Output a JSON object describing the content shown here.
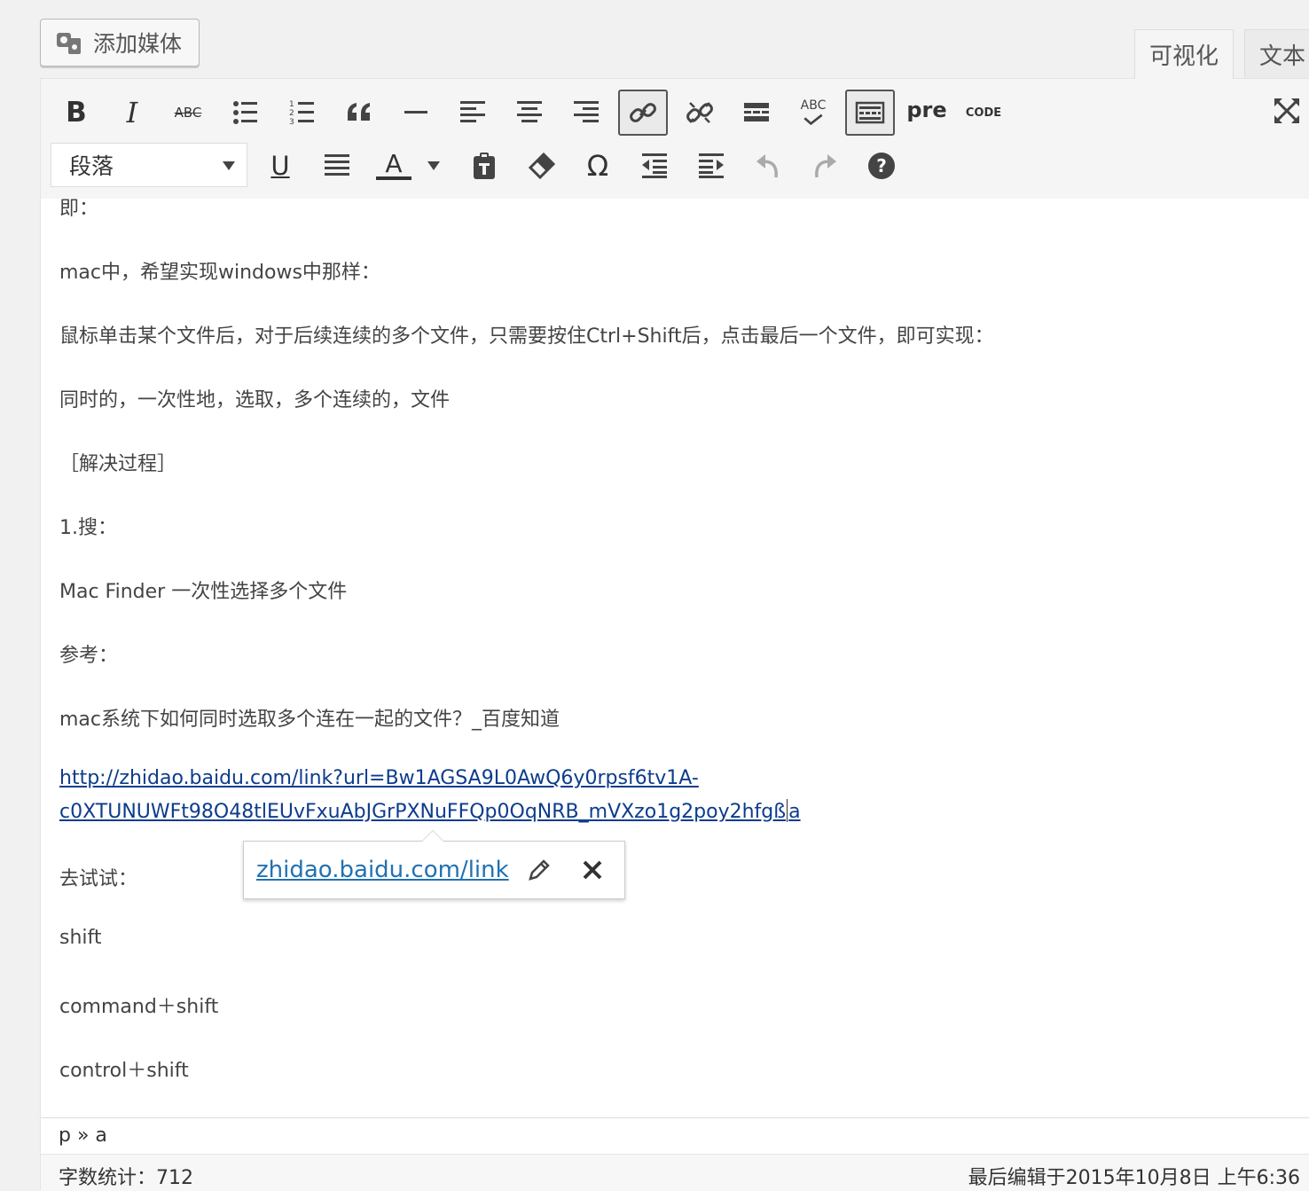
{
  "media_button": {
    "label": "添加媒体"
  },
  "tabs": [
    {
      "label": "可视化",
      "active": true
    },
    {
      "label": "文本",
      "active": false
    }
  ],
  "toolbar": {
    "row1": [
      {
        "name": "bold",
        "icon": "bold-icon",
        "label": "B"
      },
      {
        "name": "italic",
        "icon": "italic-icon",
        "label": "I"
      },
      {
        "name": "strikethrough",
        "icon": "strikethrough-icon",
        "label": "ABC"
      },
      {
        "name": "bullet-list",
        "icon": "bullet-list-icon"
      },
      {
        "name": "numbered-list",
        "icon": "numbered-list-icon"
      },
      {
        "name": "blockquote",
        "icon": "quote-icon"
      },
      {
        "name": "horizontal-line",
        "icon": "horizontal-line-icon"
      },
      {
        "name": "align-left",
        "icon": "align-left-icon"
      },
      {
        "name": "align-center",
        "icon": "align-center-icon"
      },
      {
        "name": "align-right",
        "icon": "align-right-icon"
      },
      {
        "name": "insert-link",
        "icon": "link-icon",
        "pressed": true
      },
      {
        "name": "unlink",
        "icon": "unlink-icon"
      },
      {
        "name": "read-more",
        "icon": "read-more-icon"
      },
      {
        "name": "spellcheck",
        "icon": "spellcheck-icon",
        "label": "ABC"
      },
      {
        "name": "toolbar-toggle",
        "icon": "keyboard-icon",
        "pressed": true
      },
      {
        "name": "pre",
        "label": "pre"
      },
      {
        "name": "code",
        "label": "CODE"
      },
      {
        "name": "fullscreen",
        "icon": "fullscreen-icon"
      }
    ],
    "format_select": {
      "value": "段落"
    },
    "row2": [
      {
        "name": "underline",
        "icon": "underline-icon",
        "label": "U"
      },
      {
        "name": "justify",
        "icon": "justify-icon"
      },
      {
        "name": "text-color",
        "icon": "text-color-icon",
        "label": "A"
      },
      {
        "name": "paste-as-text",
        "icon": "paste-icon"
      },
      {
        "name": "clear-formatting",
        "icon": "eraser-icon"
      },
      {
        "name": "special-character",
        "icon": "omega-icon",
        "label": "Ω"
      },
      {
        "name": "outdent",
        "icon": "outdent-icon"
      },
      {
        "name": "indent",
        "icon": "indent-icon"
      },
      {
        "name": "undo",
        "icon": "undo-icon"
      },
      {
        "name": "redo",
        "icon": "redo-icon"
      },
      {
        "name": "help",
        "icon": "help-icon",
        "label": "?"
      }
    ]
  },
  "content": {
    "lines": [
      "即：",
      "mac中，希望实现windows中那样：",
      "鼠标单击某个文件后，对于后续连续的多个文件，只需要按住Ctrl+Shift后，点击最后一个文件，即可实现：",
      "同时的，一次性地，选取，多个连续的，文件",
      "［解决过程］",
      "1.搜：",
      "Mac Finder 一次性选择多个文件",
      "参考：",
      "mac系统下如何同时选取多个连在一起的文件？_百度知道"
    ],
    "link_line1": "http://zhidao.baidu.com/link?url=Bw1AGSA9L0AwQ6y0rpsf6tv1A-",
    "link_line2a": "c0XTUNUWFt98O48tlEUvFxuAbJGrPXNuFFQp0OqNRB_mVXzo1g2poy2hfgß",
    "link_line2b": "a",
    "after_lines": [
      "去试试：",
      "shift",
      "command＋shift",
      "control＋shift"
    ]
  },
  "link_popover": {
    "url_text": "zhidao.baidu.com/link",
    "edit_icon": "pencil-icon",
    "remove_icon": "close-icon"
  },
  "path": "p » a",
  "status": {
    "word_count": "字数统计：712",
    "last_edited": "最后编辑于2015年10月8日 上午6:36"
  }
}
